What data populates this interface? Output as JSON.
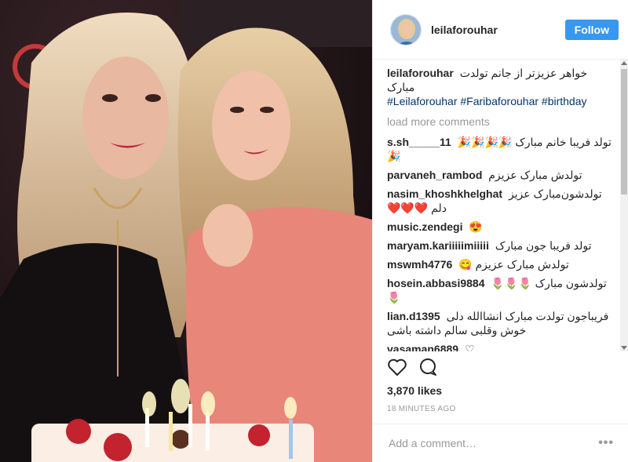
{
  "post": {
    "author": "leilaforouhar",
    "follow_label": "Follow",
    "caption": {
      "username": "leilaforouhar",
      "text": "خواهر عزیزتر از جانم تولدت مبارک",
      "hashtags": "#Leilaforouhar #Fariba​forouhar #birthday"
    },
    "load_more_label": "load more comments",
    "comments": [
      {
        "username": "s.sh_____11",
        "text": "تولد فریبا خانم مبارک 🎉🎉🎉🎉🎉"
      },
      {
        "username": "parvaneh_rambod",
        "text": "تولدش مبارک عزیزم"
      },
      {
        "username": "nasim_khoshkhelghat",
        "text": "تولدشون‌مبارک عزیز دلم ❤️❤️❤️"
      },
      {
        "username": "music.zendegi",
        "text": "😍"
      },
      {
        "username": "maryam.kariiiiimiiiii",
        "text": "تولد فریبا جون مبارک"
      },
      {
        "username": "mswmh4776",
        "text": "تولدش مبارک عزیزم 😋"
      },
      {
        "username": "hosein.abbasi9884",
        "text": "تولدشون مبارک 🌷🌷🌷🌷"
      },
      {
        "username": "lian.d1395",
        "text": "فریباجون تولدت مبارک انشاالله دلی خوش وقلبی سالم داشته باشی"
      },
      {
        "username": "vasaman6889",
        "text": "♡"
      }
    ],
    "likes": "3,870 likes",
    "time": "18 MINUTES AGO",
    "add_comment_placeholder": "Add a comment…",
    "more_options": "•••"
  },
  "colors": {
    "accent": "#3897f0",
    "hashtag": "#003569",
    "muted": "#999999"
  },
  "icons": {
    "like": "heart-outline-icon",
    "comment": "speech-bubble-icon"
  }
}
